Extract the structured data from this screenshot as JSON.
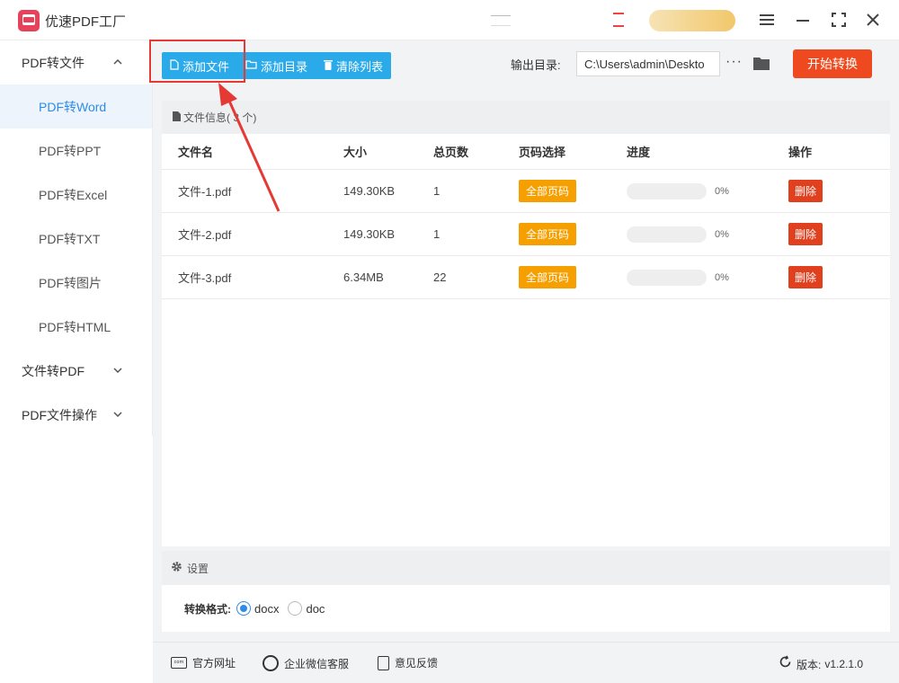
{
  "app": {
    "title": "优速PDF工厂"
  },
  "sidebar": {
    "groups": [
      {
        "label": "PDF转文件",
        "expanded": true,
        "items": [
          {
            "label": "PDF转Word",
            "active": true
          },
          {
            "label": "PDF转PPT"
          },
          {
            "label": "PDF转Excel"
          },
          {
            "label": "PDF转TXT"
          },
          {
            "label": "PDF转图片"
          },
          {
            "label": "PDF转HTML"
          }
        ]
      },
      {
        "label": "文件转PDF",
        "expanded": false
      },
      {
        "label": "PDF文件操作",
        "expanded": false
      }
    ]
  },
  "toolbar": {
    "add_file": "添加文件",
    "add_dir": "添加目录",
    "clear_list": "清除列表",
    "output_label": "输出目录:",
    "output_path": "C:\\Users\\admin\\Deskto",
    "start_button": "开始转换"
  },
  "file_panel": {
    "header_label": "文件信息",
    "header_count": "( 3 个)",
    "columns": {
      "name": "文件名",
      "size": "大小",
      "pages": "总页数",
      "page_select": "页码选择",
      "progress": "进度",
      "action": "操作"
    },
    "rows": [
      {
        "name": "文件-1.pdf",
        "size": "149.30KB",
        "pages": "1",
        "page_select": "全部页码",
        "progress": "0%",
        "progress_value": 0,
        "action": "删除"
      },
      {
        "name": "文件-2.pdf",
        "size": "149.30KB",
        "pages": "1",
        "page_select": "全部页码",
        "progress": "0%",
        "progress_value": 0,
        "action": "删除"
      },
      {
        "name": "文件-3.pdf",
        "size": "6.34MB",
        "pages": "22",
        "page_select": "全部页码",
        "progress": "0%",
        "progress_value": 0,
        "action": "删除"
      }
    ]
  },
  "settings": {
    "title": "设置",
    "format_label": "转换格式:",
    "options": [
      {
        "label": "docx",
        "selected": true
      },
      {
        "label": "doc",
        "selected": false
      }
    ]
  },
  "footer": {
    "site": "官方网址",
    "wechat": "企业微信客服",
    "feedback": "意见反馈",
    "version_label": "版本:",
    "version": "v1.2.1.0"
  },
  "colors": {
    "accent": "#2aaae9",
    "start": "#ef4a1f",
    "tag": "#f5a000",
    "delete": "#e0401e",
    "highlight": "#e53935"
  }
}
